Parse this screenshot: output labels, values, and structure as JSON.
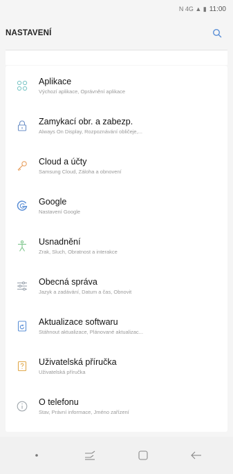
{
  "status_bar": {
    "time": "11:00",
    "icons": "N 4G ▲ ▮"
  },
  "header": {
    "title": "NASTAVENÍ"
  },
  "items": [
    {
      "label": "Aplikace",
      "sub": "Výchozí aplikace, Oprávnění aplikace",
      "icon": "apps-grid-icon",
      "color": "#7ec8c8"
    },
    {
      "label": "Zamykací obr. a zabezp.",
      "sub": "Always On Display, Rozpoznávání obličeje,...",
      "icon": "lock-icon",
      "color": "#6b8fc7"
    },
    {
      "label": "Cloud a účty",
      "sub": "Samsung Cloud, Záloha a obnovení",
      "icon": "key-icon",
      "color": "#e8a060"
    },
    {
      "label": "Google",
      "sub": "Nastavení Google",
      "icon": "google-icon",
      "color": "#5b8fd6"
    },
    {
      "label": "Usnadnění",
      "sub": "Zrak, Sluch, Obratnost a interakce",
      "icon": "accessibility-icon",
      "color": "#7cc58a"
    },
    {
      "label": "Obecná správa",
      "sub": "Jazyk a zadávání, Datum a čas, Obnovit",
      "icon": "sliders-icon",
      "color": "#9aa3ad"
    },
    {
      "label": "Aktualizace softwaru",
      "sub": "Stáhnout aktualizace, Plánované aktualizac...",
      "icon": "software-update-icon",
      "color": "#5b8fd6"
    },
    {
      "label": "Uživatelská příručka",
      "sub": "Uživatelská příručka",
      "icon": "user-manual-icon",
      "color": "#e0a84a"
    },
    {
      "label": "O telefonu",
      "sub": "Stav, Právní informace, Jméno zařízení",
      "icon": "info-icon",
      "color": "#a0a7ad"
    }
  ],
  "nav": [
    {
      "name": "nav-dot-icon"
    },
    {
      "name": "recent-apps-icon"
    },
    {
      "name": "home-icon"
    },
    {
      "name": "back-icon"
    }
  ]
}
